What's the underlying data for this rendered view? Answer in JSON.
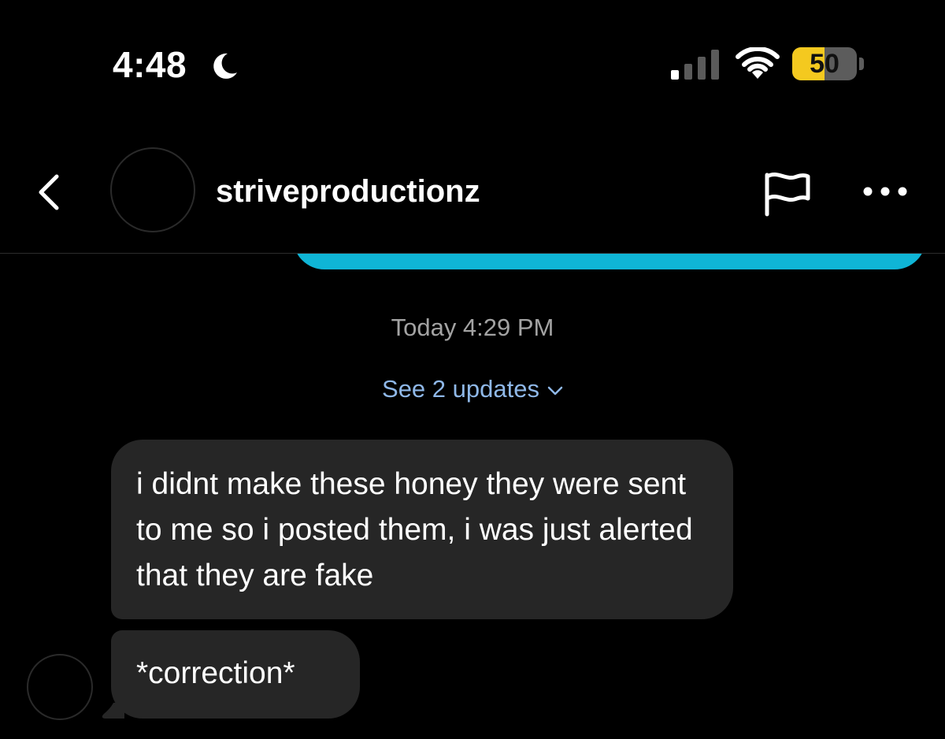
{
  "status_bar": {
    "time": "4:48",
    "focus_icon": "moon-icon",
    "signal_icon": "cellular-signal-icon",
    "wifi_icon": "wifi-icon",
    "battery_level": "50",
    "battery_fraction": 0.5,
    "battery_color": "#f4c91f"
  },
  "header": {
    "back_icon": "chevron-left-icon",
    "username": "striveproductionz",
    "report_icon": "flag-icon",
    "more_icon": "more-dots-icon"
  },
  "thread": {
    "sent_bubble_color": "#0fb5d6",
    "timestamp": "Today 4:29 PM",
    "updates_link": "See 2 updates",
    "updates_icon": "chevron-down-icon",
    "messages": [
      {
        "sender": "other",
        "text": "i didnt make these honey they were sent to me so i posted them, i was just alerted that they are fake"
      },
      {
        "sender": "other",
        "text": "*correction*"
      }
    ]
  }
}
